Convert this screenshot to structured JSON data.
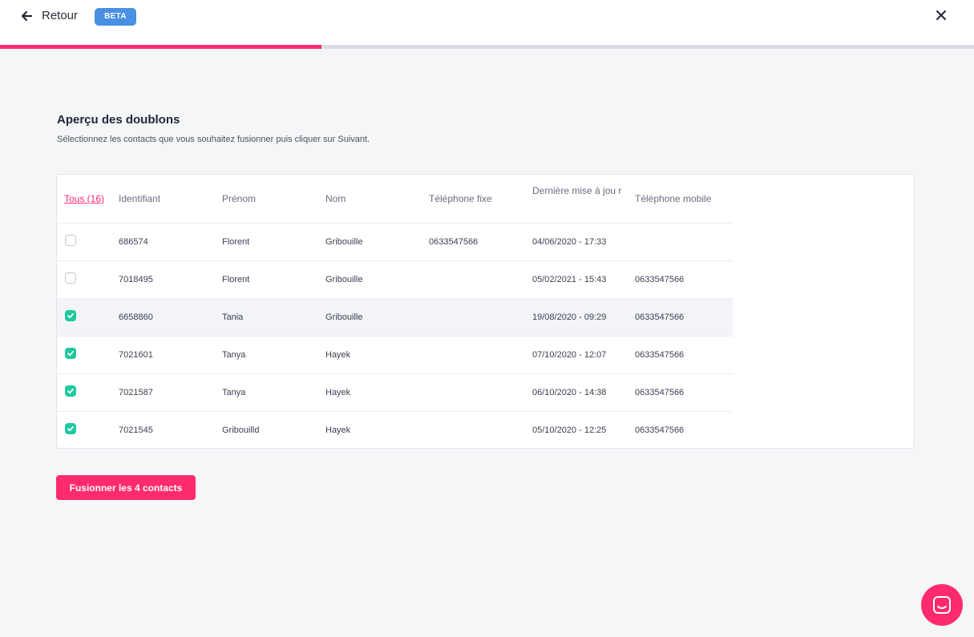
{
  "header": {
    "back_label": "Retour",
    "beta_badge": "BETA",
    "progress_fraction": 0.33
  },
  "page": {
    "title": "Aperçu des doublons",
    "subtitle": "Sélectionnez les contacts que vous souhaitez fusionner puis cliquer sur Suivant."
  },
  "table": {
    "columns": {
      "all": "Tous (16)",
      "id": "Identifiant",
      "firstname": "Prénom",
      "lastname": "Nom",
      "phone": "Téléphone fixe",
      "updated": "Dernière mise à jou r",
      "mobile": "Téléphone mobile"
    },
    "rows": [
      {
        "checked": false,
        "id": "686574",
        "firstname": "Florent",
        "lastname": "Gribouille",
        "phone": "0633547566",
        "updated": "04/06/2020 - 17:33",
        "mobile": ""
      },
      {
        "checked": false,
        "id": "7018495",
        "firstname": "Florent",
        "lastname": "Gribouille",
        "phone": "",
        "updated": "05/02/2021 - 15:43",
        "mobile": "0633547566"
      },
      {
        "checked": true,
        "id": "6658860",
        "firstname": "Tania",
        "lastname": "Gribouille",
        "phone": "",
        "updated": "19/08/2020 - 09:29",
        "mobile": "0633547566"
      },
      {
        "checked": true,
        "id": "7021601",
        "firstname": "Tanya",
        "lastname": "Hayek",
        "phone": "",
        "updated": "07/10/2020 - 12:07",
        "mobile": "0633547566"
      },
      {
        "checked": true,
        "id": "7021587",
        "firstname": "Tanya",
        "lastname": "Hayek",
        "phone": "",
        "updated": "06/10/2020 - 14:38",
        "mobile": "0633547566"
      },
      {
        "checked": true,
        "id": "7021545",
        "firstname": "Gribouilld",
        "lastname": "Hayek",
        "phone": "",
        "updated": "05/10/2020 - 12:25",
        "mobile": "0633547566"
      }
    ]
  },
  "actions": {
    "merge_label": "Fusionner les 4 contacts"
  },
  "icons": {
    "back": "arrow-left-icon",
    "close": "close-icon",
    "checkbox_on": "check-icon",
    "chat": "chat-icon"
  },
  "colors": {
    "accent": "#ff2b6e",
    "checked": "#1dc9a0",
    "beta": "#4a90e2"
  }
}
